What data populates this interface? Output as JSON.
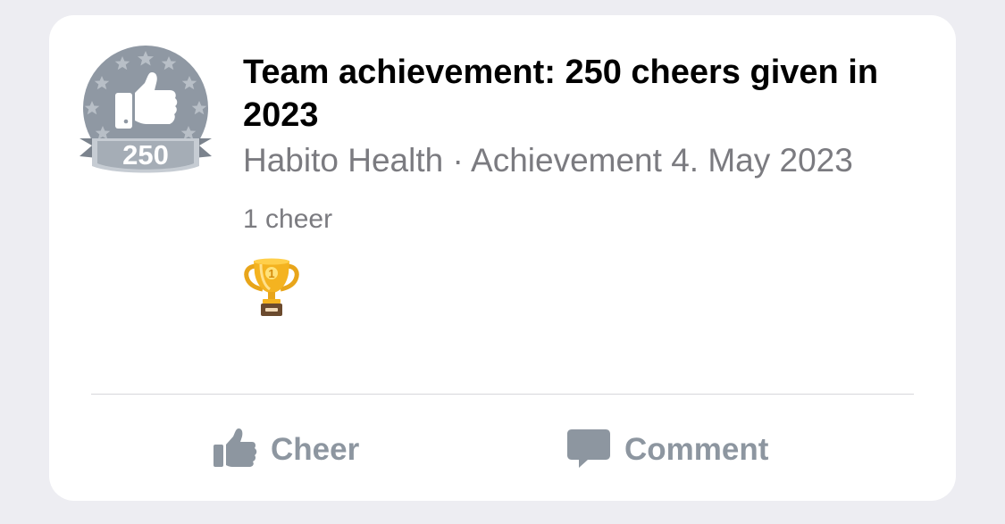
{
  "post": {
    "badge_number": "250",
    "title": "Team achievement: 250 cheers given in 2023",
    "meta": "Habito Health · Achievement 4. May 2023",
    "cheer_count": "1 cheer",
    "trophy_number": "1"
  },
  "actions": {
    "cheer_label": "Cheer",
    "comment_label": "Comment"
  },
  "colors": {
    "background": "#ededf2",
    "card": "#ffffff",
    "badge_grey": "#8f98a3",
    "action_grey": "#8d96a0",
    "trophy_gold": "#f2b01d"
  },
  "icons": {
    "badge": "thumbs-up-badge-icon",
    "reaction": "trophy-icon",
    "cheer": "thumbs-up-icon",
    "comment": "speech-bubble-icon"
  }
}
